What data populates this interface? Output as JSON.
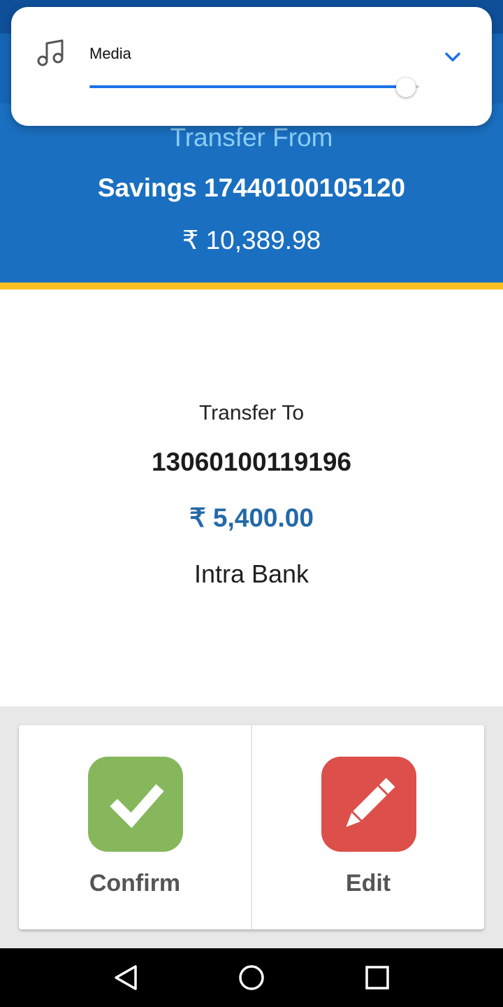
{
  "transfer_from": {
    "label": "Transfer From",
    "account": "Savings 17440100105120",
    "balance": "₹ 10,389.98"
  },
  "transfer_to": {
    "label": "Transfer To",
    "account": "13060100119196",
    "amount": "₹ 5,400.00",
    "type": "Intra Bank"
  },
  "actions": {
    "confirm_label": "Confirm",
    "confirm_icon": "check-icon",
    "edit_label": "Edit",
    "edit_icon": "pencil-icon"
  },
  "volume_panel": {
    "label": "Media",
    "icon": "music-note-icon",
    "level": 0.96,
    "expand_icon": "chevron-down-icon"
  },
  "nav_bar": {
    "back_icon": "back-triangle-icon",
    "home_icon": "home-circle-icon",
    "recents_icon": "recents-square-icon"
  },
  "colors": {
    "header_blue": "#1a6fc0",
    "accent_yellow": "#fbbf1f",
    "amount_blue": "#2469a8",
    "confirm_green": "#86b75d",
    "edit_red": "#dd4f4b",
    "slider_blue": "#1a73e8"
  }
}
